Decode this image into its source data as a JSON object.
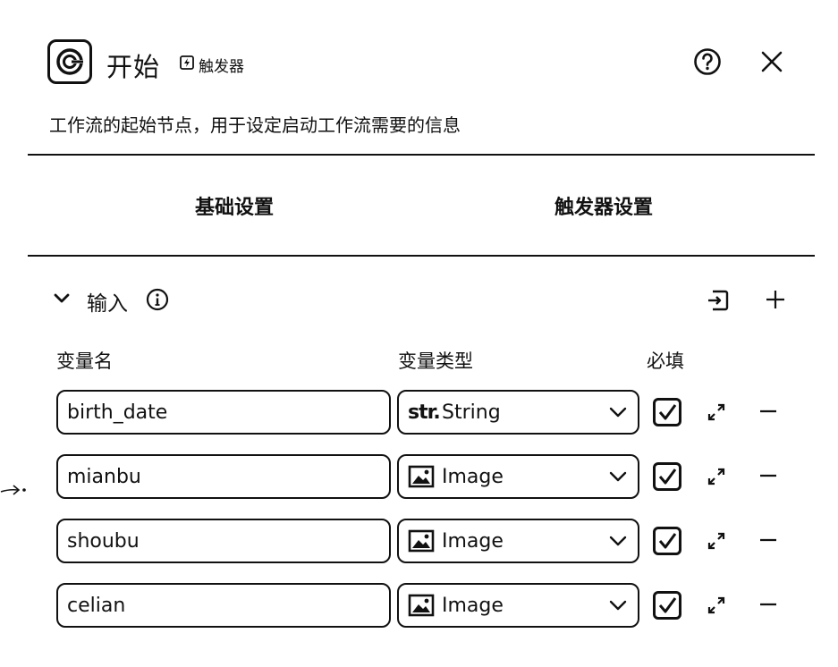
{
  "header": {
    "title": "开始",
    "tag": "触发器",
    "description": "工作流的起始节点，用于设定启动工作流需要的信息",
    "icons": {
      "node": "start-node-icon",
      "help": "help-circle-icon",
      "close": "close-icon",
      "tag": "trigger-icon"
    }
  },
  "tabs": [
    {
      "label": "基础设置"
    },
    {
      "label": "触发器设置"
    }
  ],
  "input_section": {
    "title": "输入",
    "icons": {
      "toggle": "chevron-down-icon",
      "info": "info-icon",
      "import": "import-icon",
      "add": "plus-icon"
    },
    "columns": {
      "name": "变量名",
      "type": "变量类型",
      "required": "必填"
    },
    "rows": [
      {
        "name": "birth_date",
        "type_icon_text": "str.",
        "type": "String",
        "required": true
      },
      {
        "name": "mianbu",
        "type_icon_text": "",
        "type": "Image",
        "required": true
      },
      {
        "name": "shoubu",
        "type_icon_text": "",
        "type": "Image",
        "required": true
      },
      {
        "name": "celian",
        "type_icon_text": "",
        "type": "Image",
        "required": true
      }
    ]
  }
}
